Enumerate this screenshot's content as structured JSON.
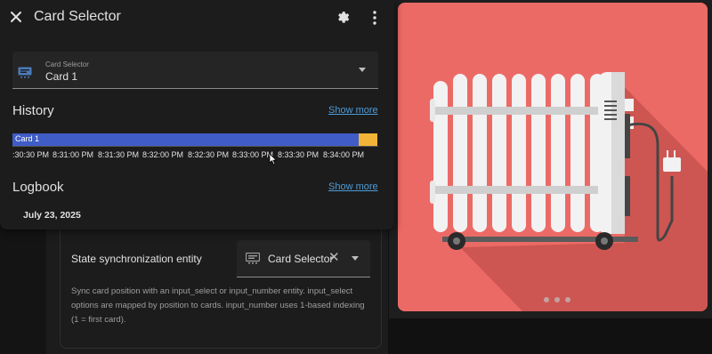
{
  "dialog": {
    "title": "Card Selector",
    "entity_field": {
      "label": "Card Selector",
      "value": "Card 1"
    },
    "history": {
      "title": "History",
      "show_more": "Show more",
      "timeline": {
        "state_label": "Card 1",
        "card1_color": "#3f5cc7",
        "other_color": "#f1b436",
        "card1_fraction": 0.949,
        "ticks": [
          ":30:30 PM",
          "8:31:00 PM",
          "8:31:30 PM",
          "8:32:00 PM",
          "8:32:30 PM",
          "8:33:00 PM",
          "8:33:30 PM",
          "8:34:00 PM"
        ]
      }
    },
    "logbook": {
      "title": "Logbook",
      "show_more": "Show more",
      "date": "July 23, 2025"
    }
  },
  "sync": {
    "label": "State synchronization entity",
    "value": "Card Selector",
    "help": "Sync card position with an input_select or input_number entity. input_select options are mapped by position to cards. input_number uses 1-based indexing (1 = first card)."
  },
  "preview": {
    "background": "#ec6a66",
    "image": "radiator-illustration",
    "page_dots": 3
  },
  "colors": {
    "accent_link": "#4e9bd7",
    "entity_icon": "#4a7ab8"
  }
}
